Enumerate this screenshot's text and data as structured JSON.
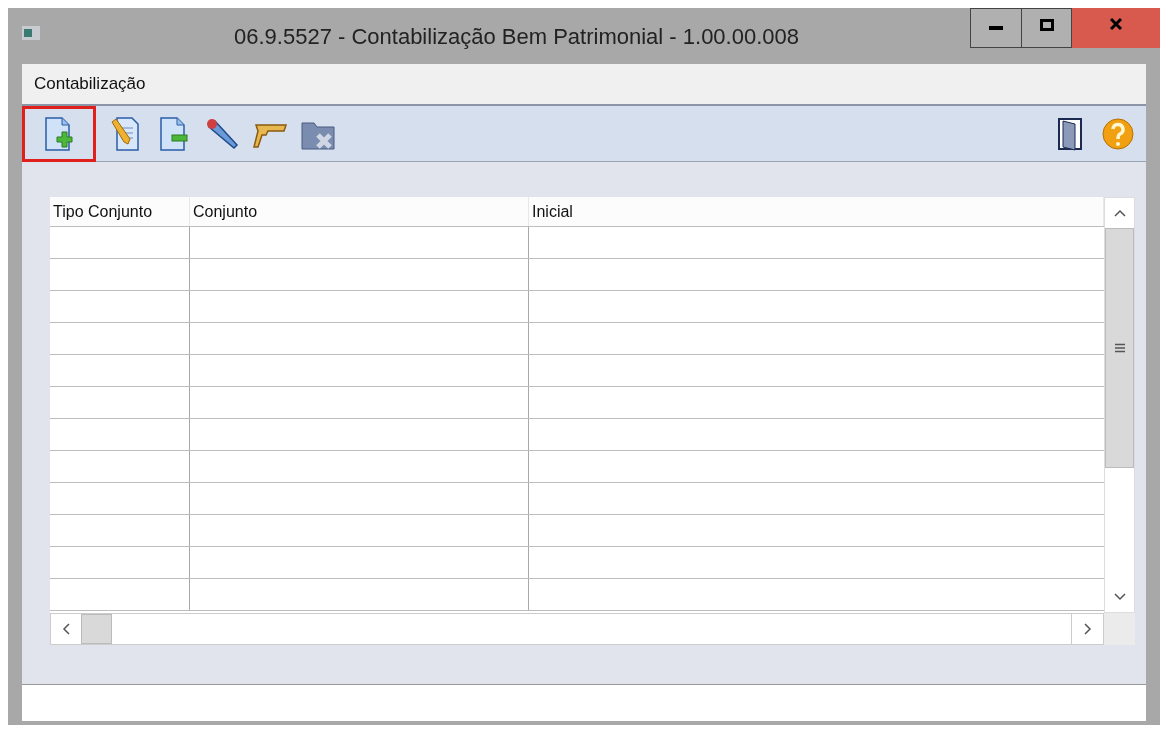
{
  "window": {
    "title": "06.9.5527 - Contabilização Bem Patrimonial - 1.00.00.008"
  },
  "menu": [
    "Contabilização"
  ],
  "toolbar": [
    {
      "kind": "new",
      "highlighted": true
    },
    {
      "kind": "edit",
      "highlighted": false
    },
    {
      "kind": "remove",
      "highlighted": false
    },
    {
      "kind": "marker",
      "highlighted": false
    },
    {
      "kind": "gun",
      "highlighted": false
    },
    {
      "kind": "folder",
      "highlighted": false
    }
  ],
  "toolbar_right": [
    {
      "kind": "exit"
    },
    {
      "kind": "help"
    }
  ],
  "table": {
    "columns": [
      "Tipo Conjunto",
      "Conjunto",
      "Inicial"
    ]
  }
}
